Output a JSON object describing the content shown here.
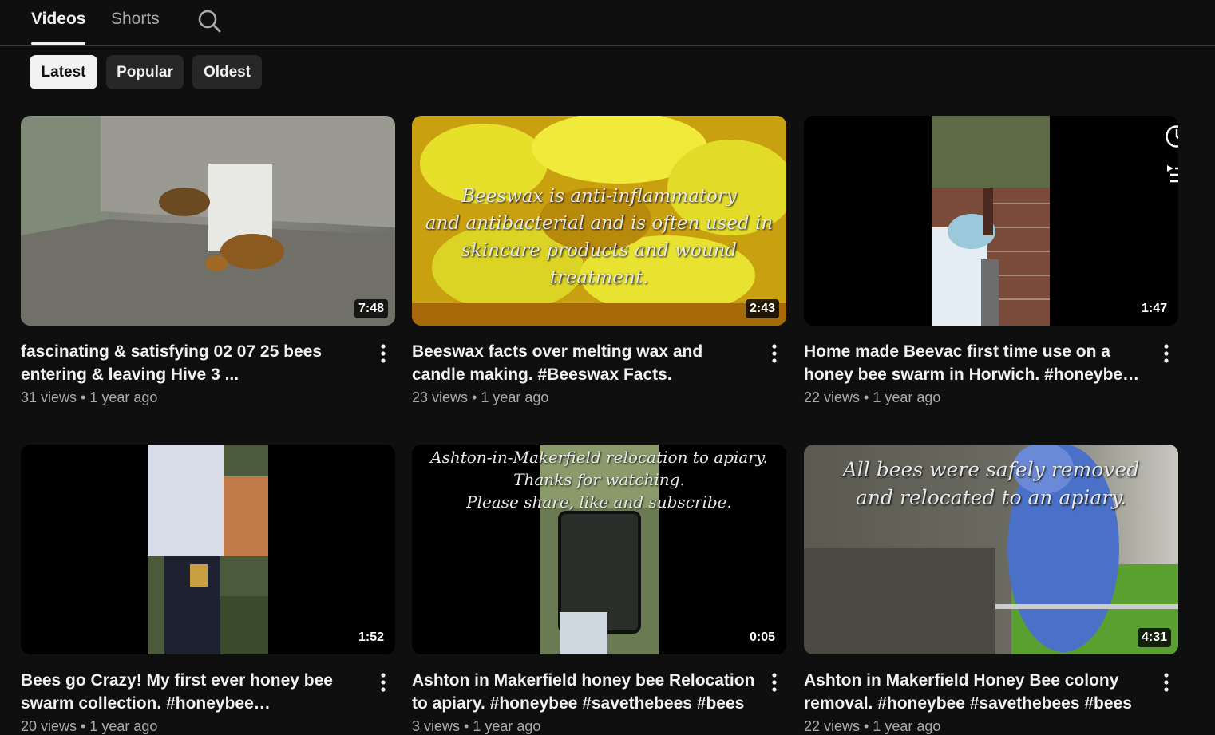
{
  "tabs": [
    {
      "label": "Videos",
      "active": true
    },
    {
      "label": "Shorts",
      "active": false
    }
  ],
  "icons": {
    "search": "search-icon",
    "more": "more-vert-icon",
    "watch_later": "clock-icon",
    "add_to_queue": "add-to-queue-icon"
  },
  "chips": [
    {
      "label": "Latest",
      "selected": true
    },
    {
      "label": "Popular",
      "selected": false
    },
    {
      "label": "Oldest",
      "selected": false
    }
  ],
  "videos": [
    {
      "title": "fascinating & satisfying 02 07 25 bees entering & leaving Hive 3 ...",
      "views": "31 views",
      "age": "1 year ago",
      "duration": "7:48",
      "thumbnail_text": []
    },
    {
      "title": "Beeswax facts over melting wax and candle making. #Beeswax Facts.",
      "views": "23 views",
      "age": "1 year ago",
      "duration": "2:43",
      "thumbnail_text": [
        "Beeswax is anti-inflammatory",
        "and antibacterial and is often used in",
        "skincare products and wound treatment."
      ]
    },
    {
      "title": "Home made Beevac first time use on a honey bee swarm in Horwich. #honeybee ...",
      "views": "22 views",
      "age": "1 year ago",
      "duration": "1:47",
      "thumbnail_text": []
    },
    {
      "title": "Bees go Crazy! My first ever honey bee swarm collection. #honeybee #savethebees",
      "views": "20 views",
      "age": "1 year ago",
      "duration": "1:52",
      "thumbnail_text": []
    },
    {
      "title": "Ashton in Makerfield honey bee Relocation to apiary. #honeybee #savethebees #bees",
      "views": "3 views",
      "age": "1 year ago",
      "duration": "0:05",
      "thumbnail_text": [
        "Ashton-in-Makerfield relocation to apiary.",
        "Thanks for watching.",
        "Please share, like and subscribe."
      ]
    },
    {
      "title": "Ashton in Makerfield Honey Bee colony removal. #honeybee #savethebees #bees",
      "views": "22 views",
      "age": "1 year ago",
      "duration": "4:31",
      "thumbnail_text": [
        "All bees were safely removed",
        "and relocated to an apiary."
      ]
    }
  ],
  "meta_separator": "•",
  "colors": {
    "background": "#0f0f0f",
    "chip_bg": "#272727",
    "chip_selected_bg": "#f1f1f1",
    "text_primary": "#f1f1f1",
    "text_secondary": "#aaaaaa"
  }
}
